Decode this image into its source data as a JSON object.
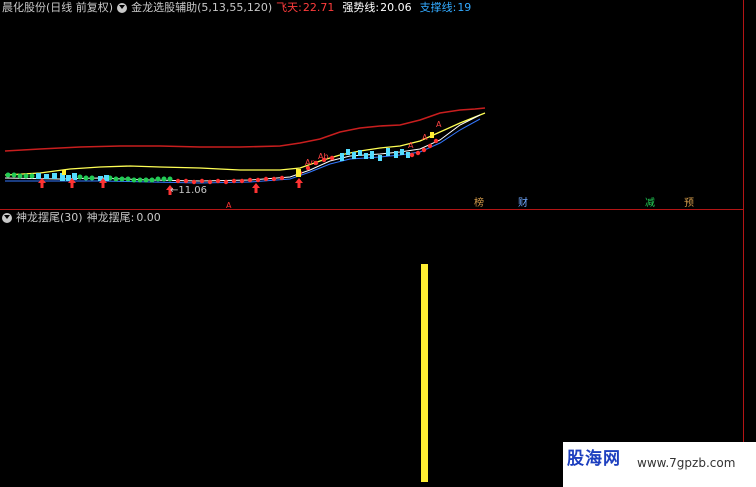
{
  "main_header": {
    "stock_title": "晨化股份(日线 前复权)",
    "indicator_name": "金龙选股辅助(5,13,55,120)",
    "feitian_label": "飞天:",
    "feitian_value": "22.71",
    "qiangshi_label": "强势线:",
    "qiangshi_value": "20.06",
    "zhicheng_label": "支撑线:",
    "zhicheng_value": "19"
  },
  "main_chart": {
    "low_price_label": "←11.06",
    "signal_markers": [
      "榜",
      "财",
      "减",
      "预"
    ],
    "bottom_marker": "A"
  },
  "sub_header": {
    "indicator_name": "神龙摆尾(30)",
    "value_label": "神龙摆尾:",
    "value": "0.00"
  },
  "watermark": {
    "logo": "股海网",
    "url": "www.7gpzb.com"
  },
  "colors": {
    "background": "#000000",
    "border": "#b31515",
    "title": "#c8c8c8",
    "feitian": "#ff3c3c",
    "qiangshi": "#ffffff",
    "zhicheng": "#33aaff",
    "upper_band": "#c81e1e",
    "mid_line": "#ffff55",
    "blue_line": "#3377ff",
    "white_line": "#ffffff",
    "green_dots": "#22cc55",
    "red_dots": "#ff3333",
    "cyan_bars": "#55ddff",
    "dragon_bar": "#ffee33"
  }
}
